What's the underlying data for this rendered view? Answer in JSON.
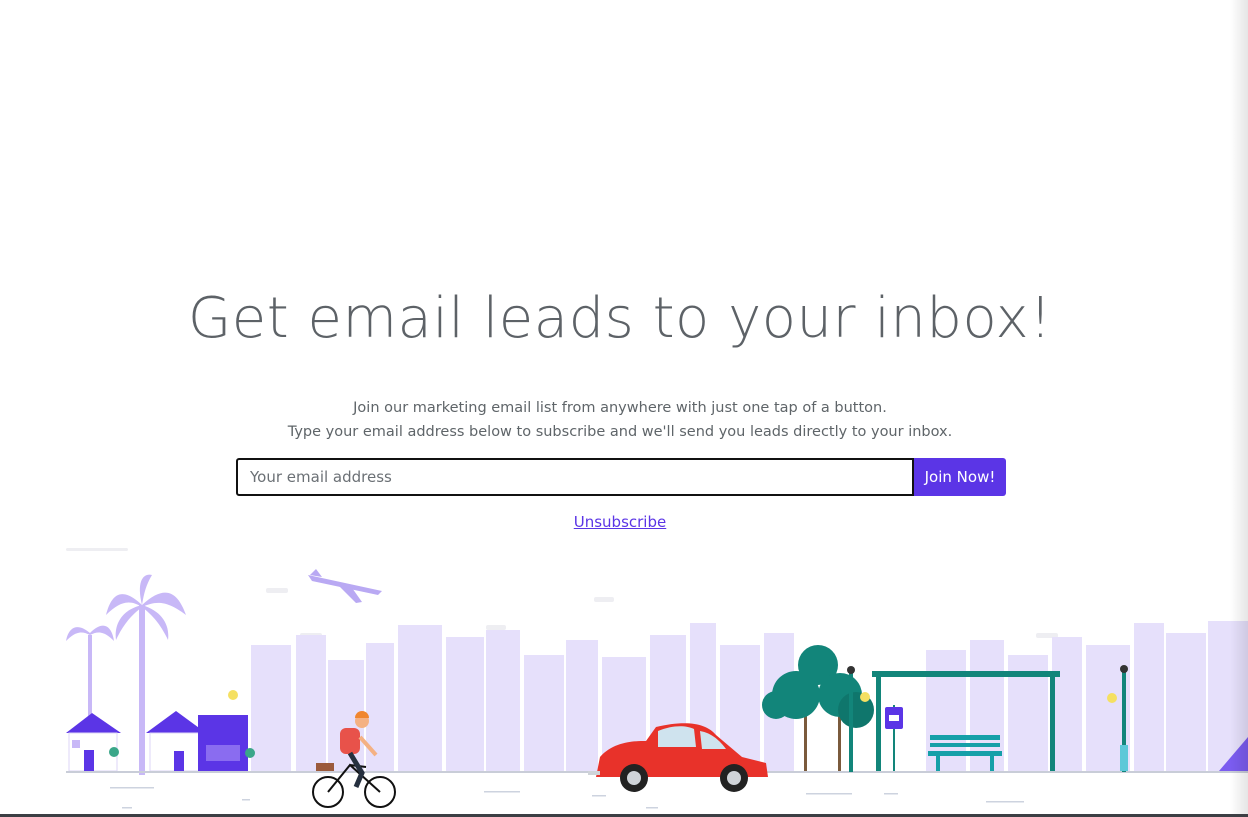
{
  "hero": {
    "title": "Get email leads to your inbox!",
    "subtitle_line1": "Join our marketing email list from anywhere with just one tap of a button.",
    "subtitle_line2": "Type your email address below to subscribe and we'll send you leads directly to your inbox."
  },
  "form": {
    "email_placeholder": "Your email address",
    "email_value": "",
    "submit_label": "Join Now!"
  },
  "links": {
    "unsubscribe": "Unsubscribe"
  },
  "colors": {
    "accent": "#5b35e6",
    "skyline": "#e4ddfb",
    "car": "#e8322a",
    "tree": "#12857a",
    "bus_stop": "#12857a"
  },
  "illustration": {
    "icons": [
      "airplane-icon",
      "palm-tree-icon",
      "house-icon",
      "cyclist-icon",
      "car-icon",
      "tree-icon",
      "bus-stop-icon",
      "bench-icon",
      "street-lamp-icon"
    ]
  }
}
